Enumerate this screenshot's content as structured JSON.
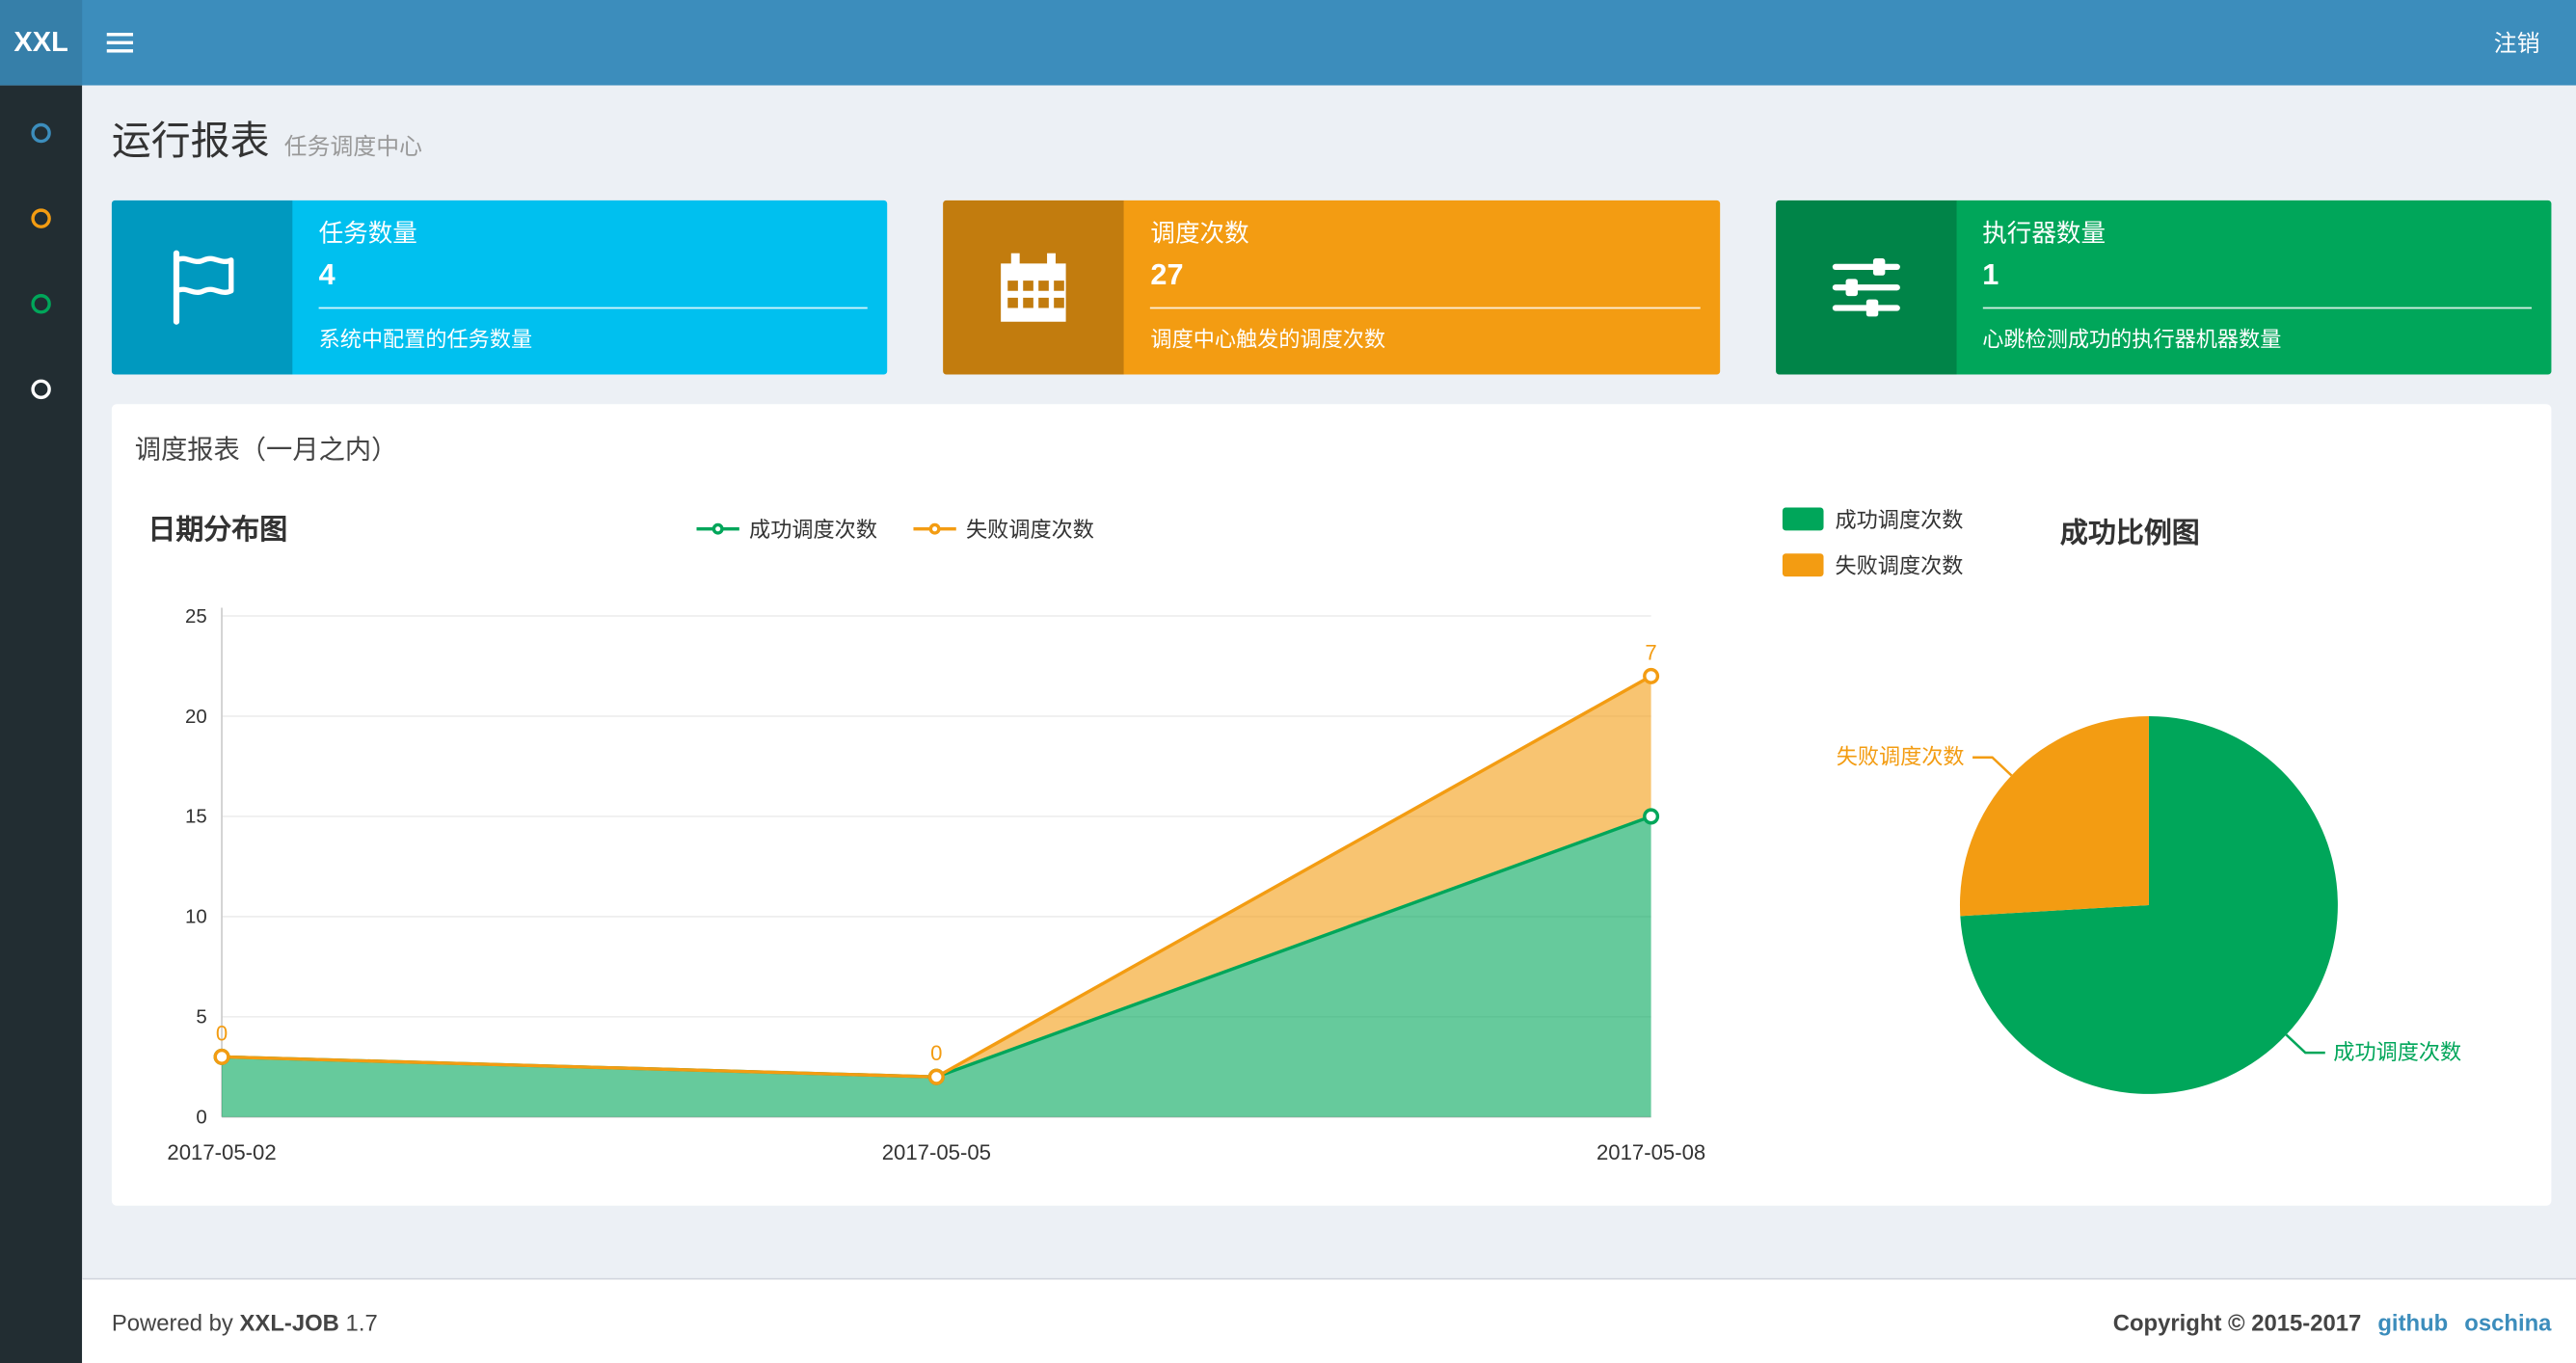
{
  "navbar": {
    "logo_mini": "XXL",
    "logout": "注销"
  },
  "sidebar": {
    "items": [
      {
        "icon": "circle-icon",
        "color": "#3c8dbc"
      },
      {
        "icon": "circle-icon",
        "color": "#f39c12"
      },
      {
        "icon": "circle-icon",
        "color": "#00a65a"
      },
      {
        "icon": "circle-icon",
        "color": "#ffffff"
      }
    ]
  },
  "header": {
    "title": "运行报表",
    "subtitle": "任务调度中心"
  },
  "info_boxes": [
    {
      "icon": "flag-icon",
      "title": "任务数量",
      "value": "4",
      "desc": "系统中配置的任务数量",
      "color": "#00c0ef"
    },
    {
      "icon": "calendar-icon",
      "title": "调度次数",
      "value": "27",
      "desc": "调度中心触发的调度次数",
      "color": "#f39c12"
    },
    {
      "icon": "sliders-icon",
      "title": "执行器数量",
      "value": "1",
      "desc": "心跳检测成功的执行器机器数量",
      "color": "#00a65a"
    }
  ],
  "panel": {
    "title": "调度报表（一月之内）"
  },
  "chart_data": [
    {
      "type": "area",
      "title": "日期分布图",
      "x": [
        "2017-05-02",
        "2017-05-05",
        "2017-05-08"
      ],
      "series": [
        {
          "name": "成功调度次数",
          "values": [
            3,
            2,
            15
          ],
          "color": "#00a65a"
        },
        {
          "name": "失败调度次数",
          "values": [
            0,
            0,
            7
          ],
          "color": "#f39c12"
        }
      ],
      "stacked": true,
      "ylim": [
        0,
        25
      ],
      "yticks": [
        0,
        5,
        10,
        15,
        20,
        25
      ],
      "point_labels": {
        "series": "失败调度次数",
        "values": [
          0,
          0,
          7
        ]
      },
      "legend_position": "top-center",
      "grid": true
    },
    {
      "type": "pie",
      "title": "成功比例图",
      "slices": [
        {
          "label": "成功调度次数",
          "value": 20,
          "color": "#00a65a"
        },
        {
          "label": "失败调度次数",
          "value": 7,
          "color": "#f39c12"
        }
      ],
      "legend_position": "top-left"
    }
  ],
  "footer": {
    "powered_prefix": "Powered by",
    "product": "XXL-JOB",
    "version": "1.7",
    "copyright": "Copyright © 2015-2017",
    "links": [
      "github",
      "oschina"
    ]
  },
  "theme": {
    "navbar_bg": "#3c8dbc",
    "logo_bg": "#367fa9",
    "sidebar_bg": "#222d32",
    "content_bg": "#ecf0f5",
    "link": "#3c8dbc"
  }
}
